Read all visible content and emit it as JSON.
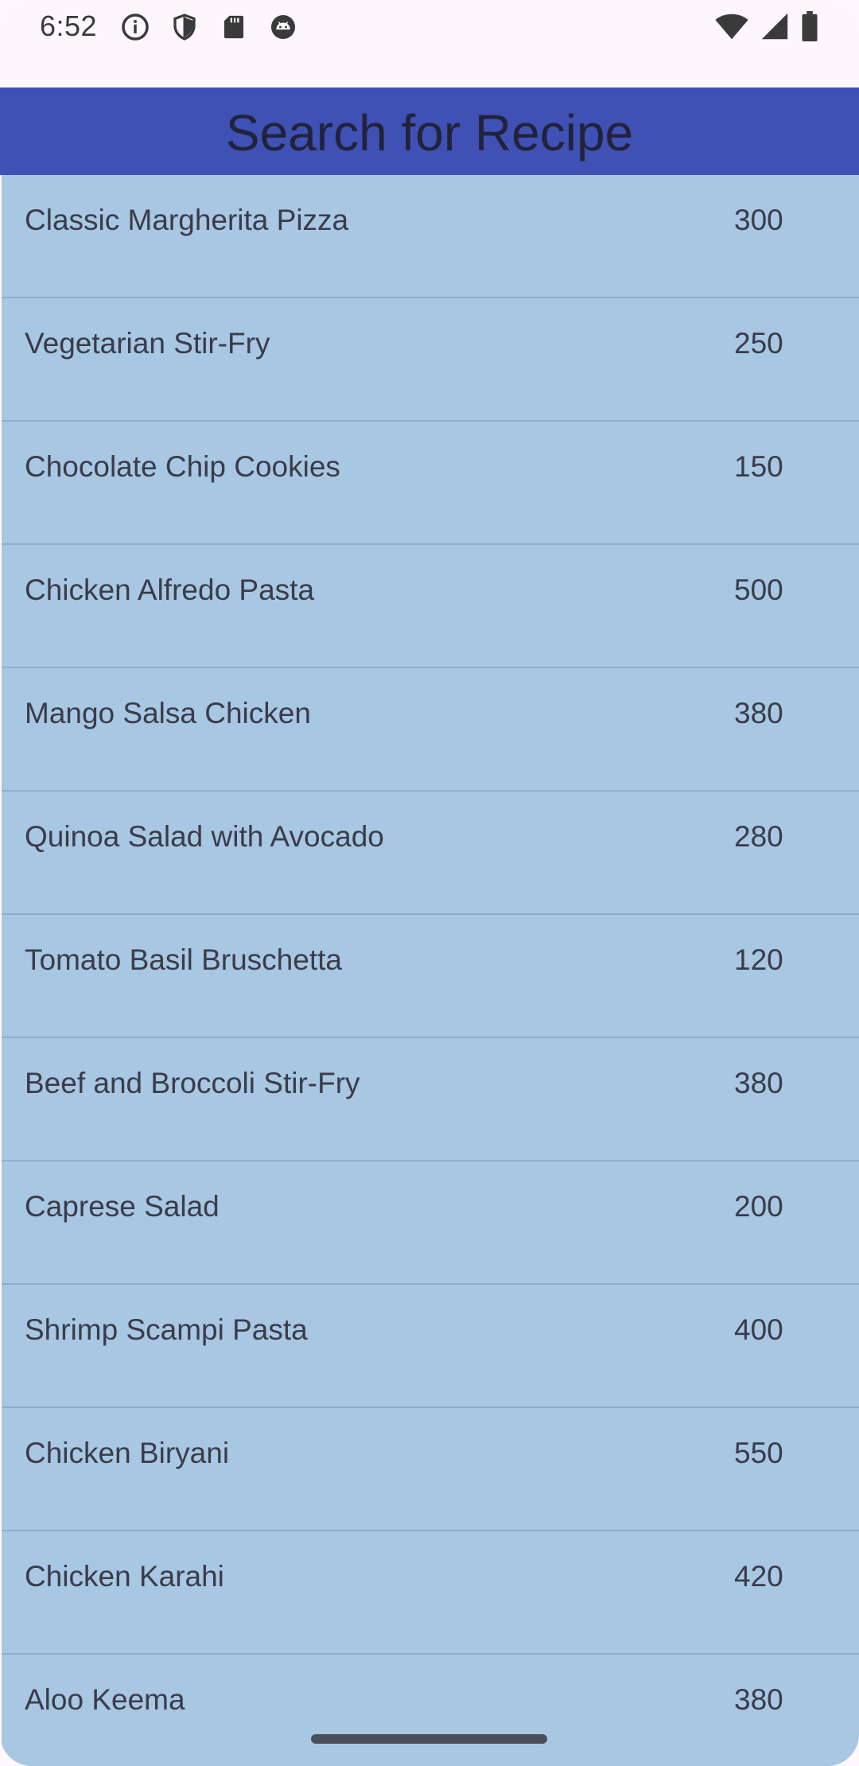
{
  "status_bar": {
    "time": "6:52",
    "left_icons": [
      "info-icon",
      "shield-icon",
      "sd-card-icon",
      "android-debug-icon"
    ],
    "right_icons": [
      "wifi-icon",
      "cellular-signal-icon",
      "battery-icon"
    ]
  },
  "app_bar": {
    "title": "Search for Recipe",
    "background_color": "#3f51b5"
  },
  "list": {
    "background_color": "#a7c7e2",
    "items": [
      {
        "name": "Classic Margherita Pizza",
        "calories": "300"
      },
      {
        "name": "Vegetarian Stir-Fry",
        "calories": "250"
      },
      {
        "name": "Chocolate Chip Cookies",
        "calories": "150"
      },
      {
        "name": "Chicken Alfredo Pasta",
        "calories": "500"
      },
      {
        "name": "Mango Salsa Chicken",
        "calories": "380"
      },
      {
        "name": "Quinoa Salad with Avocado",
        "calories": "280"
      },
      {
        "name": "Tomato Basil Bruschetta",
        "calories": "120"
      },
      {
        "name": "Beef and Broccoli Stir-Fry",
        "calories": "380"
      },
      {
        "name": "Caprese Salad",
        "calories": "200"
      },
      {
        "name": "Shrimp Scampi Pasta",
        "calories": "400"
      },
      {
        "name": "Chicken Biryani",
        "calories": "550"
      },
      {
        "name": "Chicken Karahi",
        "calories": "420"
      },
      {
        "name": "Aloo Keema",
        "calories": "380"
      }
    ]
  }
}
